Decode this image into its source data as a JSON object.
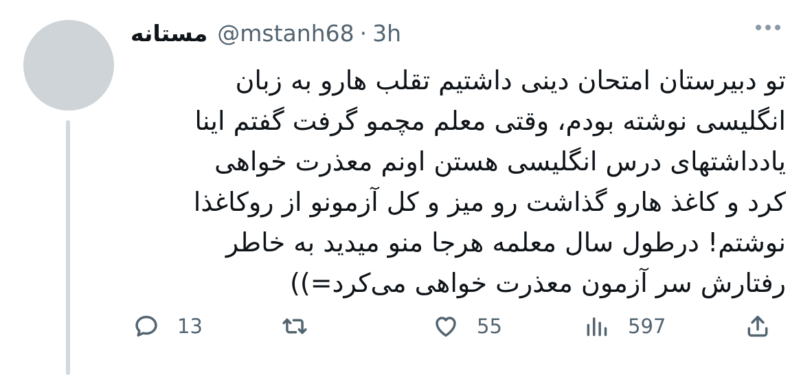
{
  "tweet": {
    "display_name": "مستانه",
    "handle": "@mstanh68",
    "separator": "·",
    "time": "3h",
    "lines": [
      "تو دبیرستان امتحان دینی داشتیم تقلب هارو به زبان",
      "انگلیسی نوشته بودم، وقتی معلم مچمو گرفت گفتم اینا",
      "یادداشتهای درس انگلیسی هستن اونم معذرت خواهی",
      "کرد و کاغذ هارو گذاشت رو میز و کل آزمونو از روکاغذا",
      "نوشتم! درطول سال معلمه هرجا منو میدید به خاطر",
      "رفتارش سر آزمون معذرت خواهی می‌کرد=))"
    ]
  },
  "actions": {
    "replies": "13",
    "likes": "55",
    "views": "597"
  },
  "icons": {
    "more": "more-horizontal-icon",
    "reply": "reply-bubble-icon",
    "retweet": "retweet-icon",
    "like": "heart-icon",
    "views": "analytics-bars-icon",
    "share": "share-upload-icon"
  },
  "colors": {
    "text": "#0f1419",
    "secondary": "#536471",
    "avatar": "#cfd4d8",
    "thread_line": "#cfd9de"
  }
}
